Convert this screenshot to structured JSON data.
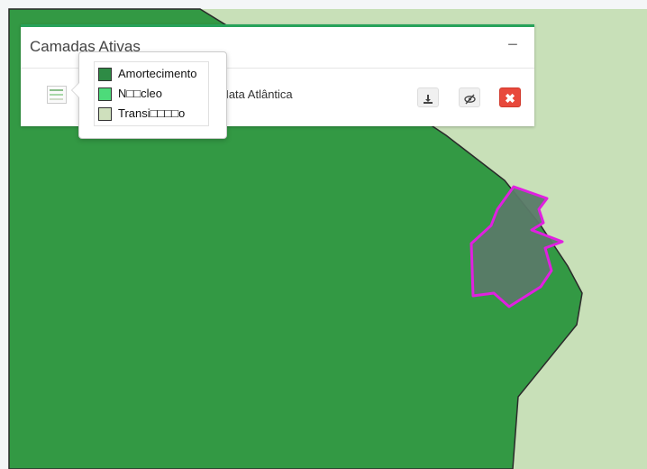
{
  "panel": {
    "title": "Camadas Ativas",
    "collapse_symbol": "−"
  },
  "layer": {
    "name": "Mata Atlântica",
    "thumb_icon": "legend-thumbnail-icon",
    "download_icon": "download-icon",
    "visibility_icon": "eye-slash-icon",
    "remove_symbol": "✖"
  },
  "legend": {
    "items": [
      {
        "label": "Amortecimento",
        "color": "#2e8b45"
      },
      {
        "label": "N□□cleo",
        "color": "#4ddb7a"
      },
      {
        "label": "Transi□□□□o",
        "color": "#cfe0bd"
      }
    ]
  },
  "map": {
    "colors": {
      "amortecimento": "#339944",
      "transicao": "#c8e0b8",
      "boundary": "#2a2a2a",
      "highlight_stroke": "#e020e0",
      "highlight_fill": "#5a7a68"
    }
  }
}
